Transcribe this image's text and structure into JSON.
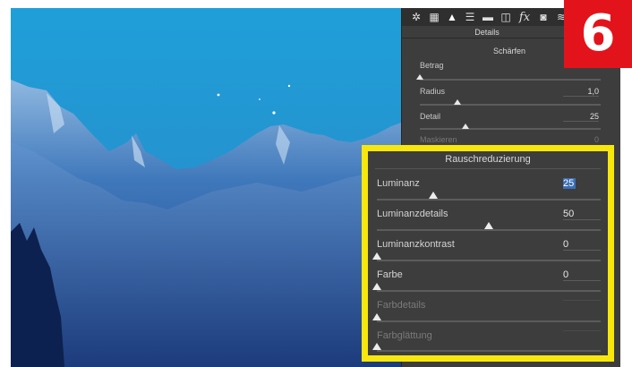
{
  "toolbar": {
    "icons": [
      "aperture-icon",
      "grid-icon",
      "mountain-icon",
      "hsl-icon",
      "split-icon",
      "lens-icon",
      "fx-icon",
      "camera-icon",
      "sliders-icon"
    ],
    "fx_label": "fx"
  },
  "panel": {
    "title": "Details",
    "sharpen": {
      "title": "Schärfen",
      "rows": [
        {
          "label": "Betrag",
          "value": "",
          "level": 0.0
        },
        {
          "label": "Radius",
          "value": "1,0",
          "level": 0.21
        },
        {
          "label": "Detail",
          "value": "25",
          "level": 0.25
        },
        {
          "label": "Maskieren",
          "value": "0",
          "level": 0.0
        }
      ]
    }
  },
  "noise": {
    "title": "Rauschreduzierung",
    "rows": [
      {
        "label": "Luminanz",
        "value": "25",
        "level": 0.25,
        "selected": true,
        "disabled": false
      },
      {
        "label": "Luminanzdetails",
        "value": "50",
        "level": 0.5,
        "selected": false,
        "disabled": false
      },
      {
        "label": "Luminanzkontrast",
        "value": "0",
        "level": 0.0,
        "selected": false,
        "disabled": false
      },
      {
        "label": "Farbe",
        "value": "0",
        "level": 0.0,
        "selected": false,
        "disabled": false
      },
      {
        "label": "Farbdetails",
        "value": "",
        "level": 0.0,
        "selected": false,
        "disabled": true
      },
      {
        "label": "Farbglättung",
        "value": "",
        "level": 0.0,
        "selected": false,
        "disabled": true
      }
    ]
  },
  "badge": {
    "number": "6"
  },
  "colors": {
    "highlight": "#f7e70c",
    "badge": "#e3131b",
    "panel": "#3d3d3d",
    "selection": "#3b6fb6"
  }
}
